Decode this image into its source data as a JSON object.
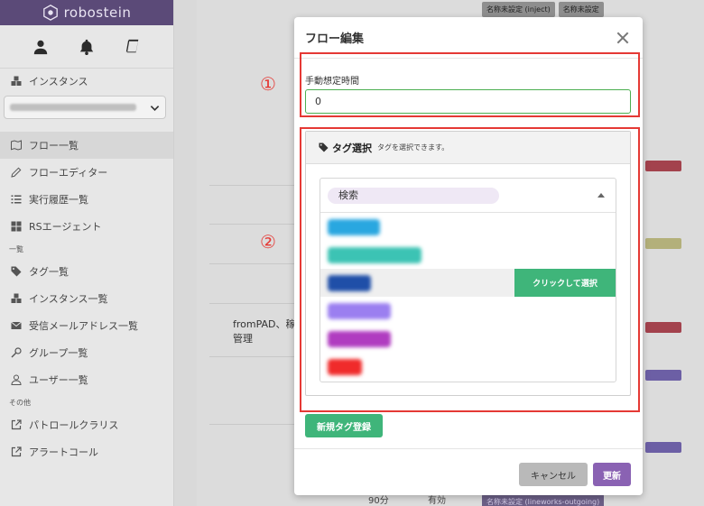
{
  "brand": {
    "name": "robostein"
  },
  "sidebar": {
    "instance_label": "インスタンス",
    "items_main": [
      {
        "label": "フロー一覧",
        "icon": "map-icon"
      },
      {
        "label": "フローエディター",
        "icon": "pencil-icon"
      },
      {
        "label": "実行履歴一覧",
        "icon": "list-icon"
      },
      {
        "label": "RSエージェント",
        "icon": "windows-icon"
      }
    ],
    "section_list": "一覧",
    "items_list": [
      {
        "label": "タグ一覧",
        "icon": "tag-icon"
      },
      {
        "label": "インスタンス一覧",
        "icon": "cubes-icon"
      },
      {
        "label": "受信メールアドレス一覧",
        "icon": "envelope-icon"
      },
      {
        "label": "グループ一覧",
        "icon": "key-icon"
      },
      {
        "label": "ユーザー一覧",
        "icon": "user-icon"
      }
    ],
    "section_other": "その他",
    "items_other": [
      {
        "label": "パトロールクラリス",
        "icon": "external-link-icon"
      },
      {
        "label": "アラートコール",
        "icon": "external-link-icon"
      }
    ]
  },
  "background": {
    "row_text": "fromPAD、稼働管理",
    "minutes": "90分",
    "valid": "有効",
    "chip1": "名称未設定 (inject)",
    "chip2": "名称未設定",
    "chip_bottom": "名称未設定 (lineworks-outgoing)"
  },
  "modal": {
    "title": "フロー編集",
    "annotations": {
      "one": "①",
      "two": "②"
    },
    "manual_time": {
      "label": "手動想定時間",
      "value": "0"
    },
    "tag_panel": {
      "title": "タグ選択",
      "subtitle": "タグを選択できます。",
      "search_placeholder": "検索",
      "select_button": "クリックして選択",
      "tags": [
        {
          "color": "#29a7e0",
          "width": 58
        },
        {
          "color": "#3cc3b4",
          "width": 104
        },
        {
          "color": "#1f4fa8",
          "width": 48
        },
        {
          "color": "#9b7ff0",
          "width": 70
        },
        {
          "color": "#b03cc0",
          "width": 70
        },
        {
          "color": "#f02b2b",
          "width": 38
        }
      ]
    },
    "new_tag_button": "新規タグ登録",
    "cancel_button": "キャンセル",
    "update_button": "更新"
  },
  "colors": {
    "brand": "#5b4a78",
    "accent_green": "#3fb57a",
    "update_purple": "#8a62b3",
    "annotation_red": "#e53935"
  }
}
